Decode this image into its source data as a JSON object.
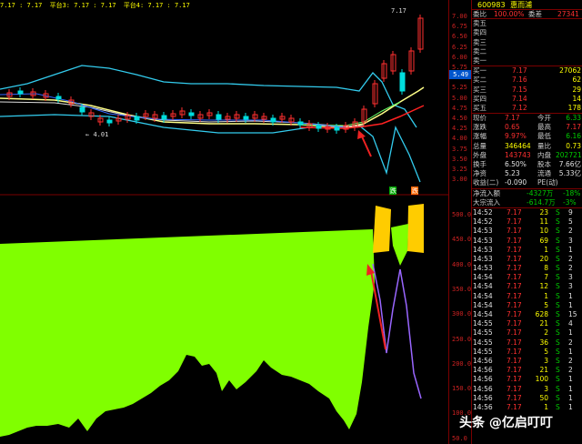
{
  "top_labels": [
    "7.17 : 7.17",
    "平台3: 7.17 : 7.17",
    "平台4: 7.17 : 7.17"
  ],
  "top_right_label": "7.17",
  "current_price_tag": "5.49",
  "price_axis": [
    "7.00",
    "6.75",
    "6.50",
    "6.25",
    "6.00",
    "5.75",
    "5.50",
    "5.25",
    "5.00",
    "4.75",
    "4.50",
    "4.25",
    "4.00",
    "3.75",
    "3.50",
    "3.25",
    "3.00"
  ],
  "volume_axis": [
    "500.0",
    "450.0",
    "400.0",
    "350.0",
    "300.0",
    "250.0",
    "200.0",
    "150.0",
    "100.0",
    "50.0"
  ],
  "low_marker": "4.01",
  "signal_labels": [
    "跌",
    "跌"
  ],
  "stock": {
    "code": "600983",
    "name": "惠而浦"
  },
  "order_ratio": {
    "label": "委比",
    "value": "100.00%",
    "diff_label": "委差",
    "diff_value": "27341"
  },
  "sell_orders": [
    {
      "label": "卖五"
    },
    {
      "label": "卖四"
    },
    {
      "label": "卖三"
    },
    {
      "label": "卖二"
    },
    {
      "label": "卖一"
    }
  ],
  "buy_orders": [
    {
      "label": "买一",
      "price": "7.17",
      "volume": "27062"
    },
    {
      "label": "买二",
      "price": "7.16",
      "volume": "62"
    },
    {
      "label": "买三",
      "price": "7.15",
      "volume": "29"
    },
    {
      "label": "买四",
      "price": "7.14",
      "volume": "14"
    },
    {
      "label": "买五",
      "price": "7.12",
      "volume": "178"
    }
  ],
  "quote": [
    {
      "l1": "现价",
      "v1": "7.17",
      "c1": "up",
      "l2": "今开",
      "v2": "6.33",
      "c2": "dn"
    },
    {
      "l1": "涨跌",
      "v1": "0.65",
      "c1": "up",
      "l2": "最高",
      "v2": "7.17",
      "c2": "up"
    },
    {
      "l1": "涨幅",
      "v1": "9.97%",
      "c1": "up",
      "l2": "最低",
      "v2": "6.16",
      "c2": "dn"
    },
    {
      "l1": "总量",
      "v1": "346464",
      "c1": "yel",
      "l2": "量比",
      "v2": "0.73",
      "c2": "yel"
    },
    {
      "l1": "外盘",
      "v1": "143743",
      "c1": "up",
      "l2": "内盘",
      "v2": "202721",
      "c2": "dn"
    },
    {
      "l1": "换手",
      "v1": "6.50%",
      "c1": "wht",
      "l2": "股本",
      "v2": "7.66亿",
      "c2": "wht"
    },
    {
      "l1": "净资",
      "v1": "5.23",
      "c1": "wht",
      "l2": "流通",
      "v2": "5.33亿",
      "c2": "wht"
    },
    {
      "l1": "收益(二)",
      "v1": "-0.090",
      "c1": "wht",
      "l2": "PE(动)",
      "v2": "",
      "c2": "wht"
    }
  ],
  "fund_flow": [
    {
      "label": "净流入额",
      "value": "-4327万",
      "pct": "-18%"
    },
    {
      "label": "大宗流入",
      "value": "-614.7万",
      "pct": "-3%"
    }
  ],
  "tape": [
    {
      "time": "14:52",
      "price": "7.17",
      "vol": "23",
      "dir": "S",
      "num": "9"
    },
    {
      "time": "14:52",
      "price": "7.17",
      "vol": "11",
      "dir": "S",
      "num": "5"
    },
    {
      "time": "14:53",
      "price": "7.17",
      "vol": "10",
      "dir": "S",
      "num": "2"
    },
    {
      "time": "14:53",
      "price": "7.17",
      "vol": "69",
      "dir": "S",
      "num": "3"
    },
    {
      "time": "14:53",
      "price": "7.17",
      "vol": "1",
      "dir": "S",
      "num": "1"
    },
    {
      "time": "14:53",
      "price": "7.17",
      "vol": "20",
      "dir": "S",
      "num": "2"
    },
    {
      "time": "14:53",
      "price": "7.17",
      "vol": "8",
      "dir": "S",
      "num": "2"
    },
    {
      "time": "14:54",
      "price": "7.17",
      "vol": "7",
      "dir": "S",
      "num": "3"
    },
    {
      "time": "14:54",
      "price": "7.17",
      "vol": "12",
      "dir": "S",
      "num": "3"
    },
    {
      "time": "14:54",
      "price": "7.17",
      "vol": "1",
      "dir": "S",
      "num": "1"
    },
    {
      "time": "14:54",
      "price": "7.17",
      "vol": "5",
      "dir": "S",
      "num": "1"
    },
    {
      "time": "14:54",
      "price": "7.17",
      "vol": "628",
      "dir": "S",
      "num": "15"
    },
    {
      "time": "14:55",
      "price": "7.17",
      "vol": "21",
      "dir": "S",
      "num": "4"
    },
    {
      "time": "14:55",
      "price": "7.17",
      "vol": "2",
      "dir": "S",
      "num": "1"
    },
    {
      "time": "14:55",
      "price": "7.17",
      "vol": "36",
      "dir": "S",
      "num": "2"
    },
    {
      "time": "14:55",
      "price": "7.17",
      "vol": "5",
      "dir": "S",
      "num": "1"
    },
    {
      "time": "14:56",
      "price": "7.17",
      "vol": "3",
      "dir": "S",
      "num": "2"
    },
    {
      "time": "14:56",
      "price": "7.17",
      "vol": "21",
      "dir": "S",
      "num": "2"
    },
    {
      "time": "14:56",
      "price": "7.17",
      "vol": "100",
      "dir": "S",
      "num": "1"
    },
    {
      "time": "14:56",
      "price": "7.17",
      "vol": "3",
      "dir": "S",
      "num": "1"
    },
    {
      "time": "14:56",
      "price": "7.17",
      "vol": "50",
      "dir": "S",
      "num": "1"
    },
    {
      "time": "14:56",
      "price": "7.17",
      "vol": "1",
      "dir": "S",
      "num": "1"
    }
  ],
  "watermark": "头条 @亿启叮叮",
  "colors": {
    "up": "#ff3030",
    "down": "#00cc00",
    "green_fill": "#80ff00",
    "yellow_fill": "#ffcc00",
    "cyan_line": "#33ccee",
    "purple_line": "#9966ff",
    "ma_yellow": "#ffff88",
    "ma_red": "#ff2222",
    "arrow": "#ee2222"
  }
}
